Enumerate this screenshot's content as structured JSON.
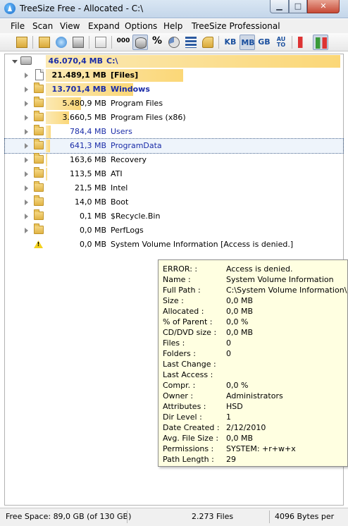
{
  "window": {
    "title": "TreeSize Free - Allocated - C:\\"
  },
  "menu": [
    "File",
    "Scan",
    "View",
    "Expand",
    "Options",
    "Help",
    "TreeSize Professional"
  ],
  "toolbar": {
    "unit_kb": "KB",
    "unit_mb": "MB",
    "unit_gb": "GB",
    "unit_auto": "AU\nTO",
    "percent": "%"
  },
  "tree": {
    "root": {
      "size": "46.070,4 MB",
      "name": "C:\\"
    },
    "items": [
      {
        "size": "21.489,1 MB",
        "name": "[Files]",
        "share": 0.466,
        "style": "bold",
        "icon": "file-icon"
      },
      {
        "size": "13.701,4 MB",
        "name": "Windows",
        "share": 0.297,
        "style": "bold-navy",
        "icon": "folder-icon"
      },
      {
        "size": "5.480,9 MB",
        "name": "Program Files",
        "share": 0.119,
        "style": "normal",
        "icon": "folder-icon"
      },
      {
        "size": "3.660,5 MB",
        "name": "Program Files (x86)",
        "share": 0.079,
        "style": "normal",
        "icon": "folder-icon"
      },
      {
        "size": "784,4 MB",
        "name": "Users",
        "share": 0.017,
        "style": "navy",
        "icon": "folder-icon"
      },
      {
        "size": "641,3 MB",
        "name": "ProgramData",
        "share": 0.014,
        "style": "navy",
        "icon": "folder-icon",
        "selected": true
      },
      {
        "size": "163,6 MB",
        "name": "Recovery",
        "share": 0.004,
        "style": "normal",
        "icon": "folder-icon"
      },
      {
        "size": "113,5 MB",
        "name": "ATI",
        "share": 0.002,
        "style": "normal",
        "icon": "folder-icon"
      },
      {
        "size": "21,5 MB",
        "name": "Intel",
        "share": 0.0,
        "style": "normal",
        "icon": "folder-icon"
      },
      {
        "size": "14,0 MB",
        "name": "Boot",
        "share": 0.0,
        "style": "normal",
        "icon": "folder-icon"
      },
      {
        "size": "0,1 MB",
        "name": "$Recycle.Bin",
        "share": 0.0,
        "style": "normal",
        "icon": "folder-icon"
      },
      {
        "size": "0,0 MB",
        "name": "PerfLogs",
        "share": 0.0,
        "style": "normal",
        "icon": "folder-icon"
      },
      {
        "size": "0,0 MB",
        "name": "System Volume Information  [Access is denied.]",
        "share": 0.0,
        "style": "normal",
        "icon": "warning-icon"
      }
    ]
  },
  "tooltip": [
    {
      "label": "ERROR:  :",
      "value": "Access is denied."
    },
    {
      "label": "Name :",
      "value": "System Volume Information"
    },
    {
      "label": "Full Path :",
      "value": " C:\\System Volume Information\\"
    },
    {
      "label": "Size :",
      "value": "0,0 MB"
    },
    {
      "label": "Allocated :",
      "value": "0,0 MB"
    },
    {
      "label": "% of Parent :",
      "value": " 0,0 %"
    },
    {
      "label": "CD/DVD size :",
      "value": "0,0 MB"
    },
    {
      "label": "Files :",
      "value": "0"
    },
    {
      "label": "Folders :",
      "value": "0"
    },
    {
      "label": "Last Change :",
      "value": ""
    },
    {
      "label": "Last Access :",
      "value": ""
    },
    {
      "label": "Compr. :",
      "value": " 0,0 %"
    },
    {
      "label": "Owner :",
      "value": "Administrators"
    },
    {
      "label": "Attributes :",
      "value": " HSD"
    },
    {
      "label": "Dir Level :",
      "value": "1"
    },
    {
      "label": "Date Created :",
      "value": "2/12/2010"
    },
    {
      "label": "Avg. File Size :",
      "value": "0,0 MB"
    },
    {
      "label": "Permissions :",
      "value": " SYSTEM: +r+w+x"
    },
    {
      "label": "Path Length :",
      "value": " 29"
    }
  ],
  "status": {
    "free_space": "Free Space: 89,0 GB  (of 130 GB)",
    "files": "2.273  Files",
    "cluster": "4096 Bytes per"
  }
}
